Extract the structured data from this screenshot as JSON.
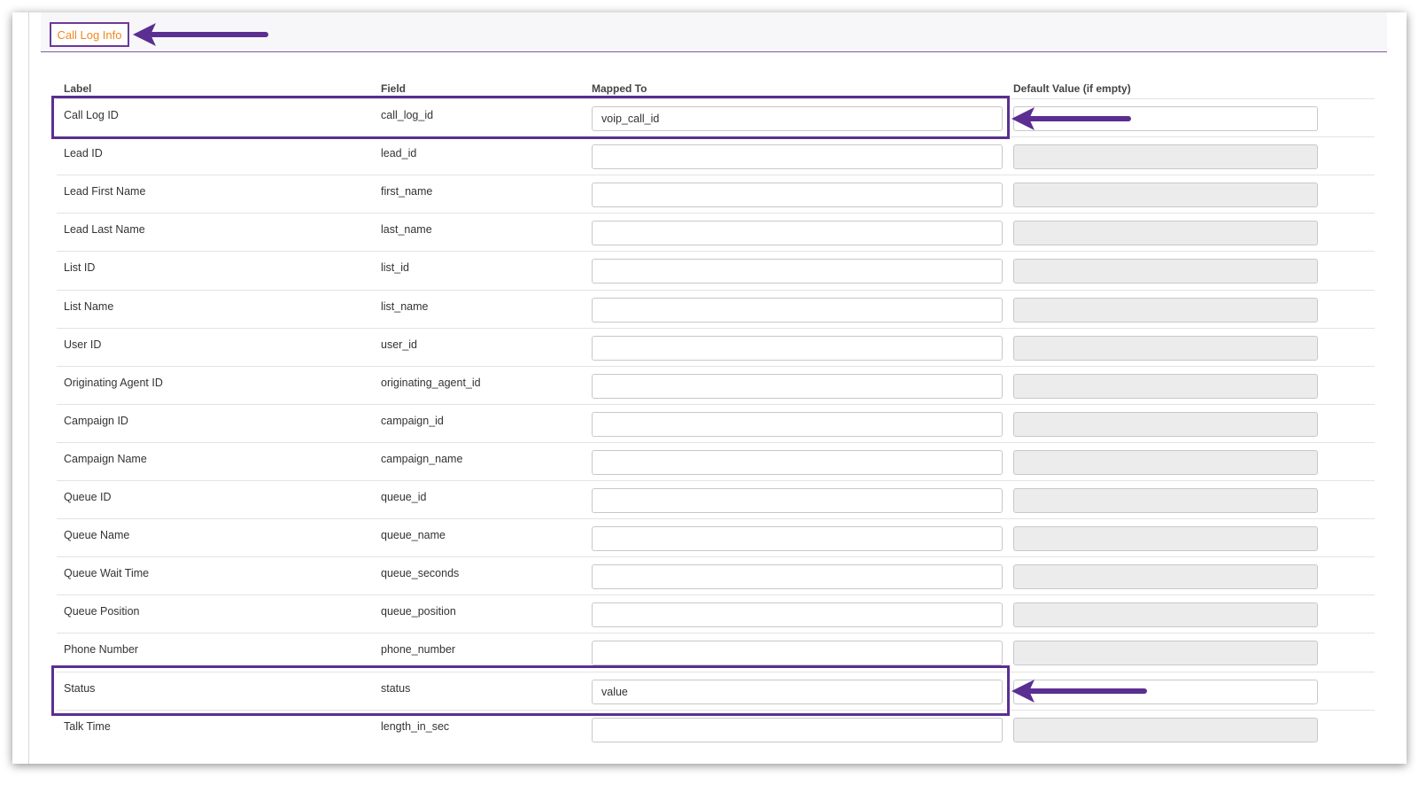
{
  "section": {
    "title": "Call Log Info"
  },
  "table": {
    "headers": {
      "label": "Label",
      "field": "Field",
      "mapped_to": "Mapped To",
      "default_value": "Default Value (if empty)"
    },
    "rows": [
      {
        "label": "Call Log ID",
        "field": "call_log_id",
        "mapped_to": "voip_call_id",
        "default": "",
        "highlighted": true
      },
      {
        "label": "Lead ID",
        "field": "lead_id",
        "mapped_to": "",
        "default": ""
      },
      {
        "label": "Lead First Name",
        "field": "first_name",
        "mapped_to": "",
        "default": ""
      },
      {
        "label": "Lead Last Name",
        "field": "last_name",
        "mapped_to": "",
        "default": ""
      },
      {
        "label": "List ID",
        "field": "list_id",
        "mapped_to": "",
        "default": ""
      },
      {
        "label": "List Name",
        "field": "list_name",
        "mapped_to": "",
        "default": ""
      },
      {
        "label": "User ID",
        "field": "user_id",
        "mapped_to": "",
        "default": ""
      },
      {
        "label": "Originating Agent ID",
        "field": "originating_agent_id",
        "mapped_to": "",
        "default": ""
      },
      {
        "label": "Campaign ID",
        "field": "campaign_id",
        "mapped_to": "",
        "default": ""
      },
      {
        "label": "Campaign Name",
        "field": "campaign_name",
        "mapped_to": "",
        "default": ""
      },
      {
        "label": "Queue ID",
        "field": "queue_id",
        "mapped_to": "",
        "default": ""
      },
      {
        "label": "Queue Name",
        "field": "queue_name",
        "mapped_to": "",
        "default": ""
      },
      {
        "label": "Queue Wait Time",
        "field": "queue_seconds",
        "mapped_to": "",
        "default": ""
      },
      {
        "label": "Queue Position",
        "field": "queue_position",
        "mapped_to": "",
        "default": ""
      },
      {
        "label": "Phone Number",
        "field": "phone_number",
        "mapped_to": "",
        "default": ""
      },
      {
        "label": "Status",
        "field": "status",
        "mapped_to": "value",
        "default": "",
        "highlighted": true
      },
      {
        "label": "Talk Time",
        "field": "length_in_sec",
        "mapped_to": "",
        "default": ""
      }
    ]
  },
  "colors": {
    "annotation": "#5b2e91",
    "section_title": "#f0881f",
    "divider": "#7d5ba6"
  }
}
